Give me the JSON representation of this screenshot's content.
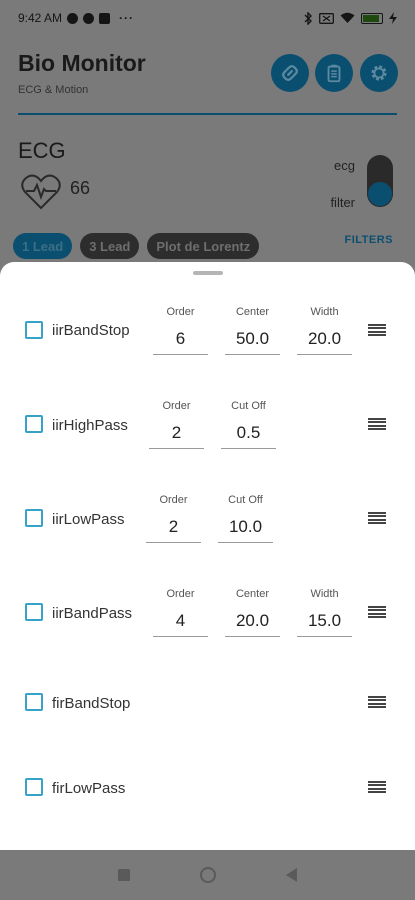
{
  "status_bar": {
    "time": "9:42 AM",
    "more": "···",
    "battery": "97"
  },
  "header": {
    "title": "Bio Monitor",
    "subtitle": "ECG & Motion"
  },
  "ecg": {
    "title": "ECG",
    "bpm": "66",
    "toggle_top_label": "ecg",
    "toggle_bottom_label": "filter"
  },
  "tabs": [
    {
      "label": "1 Lead",
      "active": true
    },
    {
      "label": "3 Lead",
      "active": false
    },
    {
      "label": "Plot de Lorentz",
      "active": false
    }
  ],
  "filters_link": "FILTERS",
  "filters": [
    {
      "name": "iirBandStop",
      "checked": false,
      "params": [
        {
          "label": "Order",
          "value": "6"
        },
        {
          "label": "Center",
          "value": "50.0"
        },
        {
          "label": "Width",
          "value": "20.0"
        }
      ]
    },
    {
      "name": "iirHighPass",
      "checked": false,
      "params": [
        {
          "label": "Order",
          "value": "2"
        },
        {
          "label": "Cut Off",
          "value": "0.5"
        }
      ]
    },
    {
      "name": "iirLowPass",
      "checked": false,
      "params": [
        {
          "label": "Order",
          "value": "2"
        },
        {
          "label": "Cut Off",
          "value": "10.0"
        }
      ]
    },
    {
      "name": "iirBandPass",
      "checked": false,
      "params": [
        {
          "label": "Order",
          "value": "4"
        },
        {
          "label": "Center",
          "value": "20.0"
        },
        {
          "label": "Width",
          "value": "15.0"
        }
      ]
    },
    {
      "name": "firBandStop",
      "checked": false,
      "params": []
    },
    {
      "name": "firLowPass",
      "checked": false,
      "params": []
    }
  ],
  "colors": {
    "accent": "#35a3c7",
    "primary_dark": "#0b4f70",
    "scrim": "#7a7a7a"
  },
  "icons": [
    "link-icon",
    "clipboard-icon",
    "gear-icon",
    "heart-pulse-icon",
    "drag-handle-icon"
  ]
}
